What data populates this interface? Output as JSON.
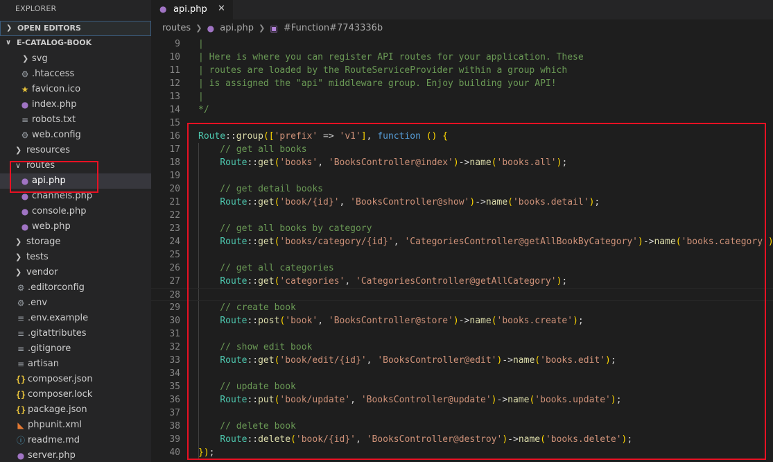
{
  "sidebar": {
    "title": "EXPLORER",
    "open_editors": "OPEN EDITORS",
    "project": "E-CATALOG-BOOK",
    "items": [
      {
        "label": "svg",
        "type": "folder",
        "level": 1,
        "icon": "chevron-right-icon"
      },
      {
        "label": ".htaccess",
        "type": "file",
        "level": 1,
        "icon": "gear-icon"
      },
      {
        "label": "favicon.ico",
        "type": "file",
        "level": 1,
        "icon": "star-icon"
      },
      {
        "label": "index.php",
        "type": "file",
        "level": 1,
        "icon": "php-icon"
      },
      {
        "label": "robots.txt",
        "type": "file",
        "level": 1,
        "icon": "lines-icon"
      },
      {
        "label": "web.config",
        "type": "file",
        "level": 1,
        "icon": "gear-icon"
      },
      {
        "label": "resources",
        "type": "folder",
        "level": 0,
        "icon": "chevron-right-icon"
      },
      {
        "label": "routes",
        "type": "folder-open",
        "level": 0,
        "icon": "chevron-down-icon"
      },
      {
        "label": "api.php",
        "type": "file",
        "level": 1,
        "icon": "php-icon",
        "selected": true
      },
      {
        "label": "channels.php",
        "type": "file",
        "level": 1,
        "icon": "php-icon"
      },
      {
        "label": "console.php",
        "type": "file",
        "level": 1,
        "icon": "php-icon"
      },
      {
        "label": "web.php",
        "type": "file",
        "level": 1,
        "icon": "php-icon"
      },
      {
        "label": "storage",
        "type": "folder",
        "level": 0,
        "icon": "chevron-right-icon"
      },
      {
        "label": "tests",
        "type": "folder",
        "level": 0,
        "icon": "chevron-right-icon"
      },
      {
        "label": "vendor",
        "type": "folder",
        "level": 0,
        "icon": "chevron-right-icon"
      },
      {
        "label": ".editorconfig",
        "type": "file",
        "level": 0,
        "icon": "gear-icon"
      },
      {
        "label": ".env",
        "type": "file",
        "level": 0,
        "icon": "gear-icon"
      },
      {
        "label": ".env.example",
        "type": "file",
        "level": 0,
        "icon": "lines-icon"
      },
      {
        "label": ".gitattributes",
        "type": "file",
        "level": 0,
        "icon": "lines-icon"
      },
      {
        "label": ".gitignore",
        "type": "file",
        "level": 0,
        "icon": "lines-icon"
      },
      {
        "label": "artisan",
        "type": "file",
        "level": 0,
        "icon": "lines-icon"
      },
      {
        "label": "composer.json",
        "type": "file",
        "level": 0,
        "icon": "json-icon"
      },
      {
        "label": "composer.lock",
        "type": "file",
        "level": 0,
        "icon": "json-icon"
      },
      {
        "label": "package.json",
        "type": "file",
        "level": 0,
        "icon": "json-icon"
      },
      {
        "label": "phpunit.xml",
        "type": "file",
        "level": 0,
        "icon": "xml-icon"
      },
      {
        "label": "readme.md",
        "type": "file",
        "level": 0,
        "icon": "info-icon"
      },
      {
        "label": "server.php",
        "type": "file",
        "level": 0,
        "icon": "php-icon"
      }
    ]
  },
  "tab": {
    "label": "api.php",
    "close": "✕"
  },
  "breadcrumb": {
    "folder": "routes",
    "file": "api.php",
    "symbol": "#Function#7743336b"
  },
  "code_lines": [
    {
      "n": "9",
      "t": "|",
      "cls": "c"
    },
    {
      "n": "10",
      "t": "| Here is where you can register API routes for your application. These",
      "cls": "c"
    },
    {
      "n": "11",
      "t": "| routes are loaded by the RouteServiceProvider within a group which",
      "cls": "c"
    },
    {
      "n": "12",
      "t": "| is assigned the \"api\" middleware group. Enjoy building your API!",
      "cls": "c"
    },
    {
      "n": "13",
      "t": "|",
      "cls": "c"
    },
    {
      "n": "14",
      "t": "*/",
      "cls": "c"
    },
    {
      "n": "15",
      "t": "",
      "cls": "p"
    },
    {
      "n": "16",
      "t": "Route::group(['prefix' => 'v1'], function () {",
      "cls": "p"
    },
    {
      "n": "17",
      "t": "    // get all books",
      "cls": "c"
    },
    {
      "n": "18",
      "t": "    Route::get('books', 'BooksController@index')->name('books.all');",
      "cls": "p"
    },
    {
      "n": "19",
      "t": "",
      "cls": "p"
    },
    {
      "n": "20",
      "t": "    // get detail books",
      "cls": "c"
    },
    {
      "n": "21",
      "t": "    Route::get('book/{id}', 'BooksController@show')->name('books.detail');",
      "cls": "p"
    },
    {
      "n": "22",
      "t": "",
      "cls": "p"
    },
    {
      "n": "23",
      "t": "    // get all books by category",
      "cls": "c"
    },
    {
      "n": "24",
      "t": "    Route::get('books/category/{id}', 'CategoriesController@getAllBookByCategory')->name('books.category');",
      "cls": "p"
    },
    {
      "n": "25",
      "t": "",
      "cls": "p"
    },
    {
      "n": "26",
      "t": "    // get all categories",
      "cls": "c"
    },
    {
      "n": "27",
      "t": "    Route::get('categories', 'CategoriesController@getAllCategory');",
      "cls": "p"
    },
    {
      "n": "28",
      "t": "",
      "cls": "p"
    },
    {
      "n": "29",
      "t": "    // create book",
      "cls": "c"
    },
    {
      "n": "30",
      "t": "    Route::post('book', 'BooksController@store')->name('books.create');",
      "cls": "p"
    },
    {
      "n": "31",
      "t": "",
      "cls": "p"
    },
    {
      "n": "32",
      "t": "    // show edit book",
      "cls": "c"
    },
    {
      "n": "33",
      "t": "    Route::get('book/edit/{id}', 'BooksController@edit')->name('books.edit');",
      "cls": "p"
    },
    {
      "n": "34",
      "t": "",
      "cls": "p"
    },
    {
      "n": "35",
      "t": "    // update book",
      "cls": "c"
    },
    {
      "n": "36",
      "t": "    Route::put('book/update', 'BooksController@update')->name('books.update');",
      "cls": "p"
    },
    {
      "n": "37",
      "t": "",
      "cls": "p"
    },
    {
      "n": "38",
      "t": "    // delete book",
      "cls": "c"
    },
    {
      "n": "39",
      "t": "    Route::delete('book/{id}', 'BooksController@destroy')->name('books.delete');",
      "cls": "p"
    },
    {
      "n": "40",
      "t": "});",
      "cls": "p"
    }
  ],
  "colors": {
    "highlight": "#e81123",
    "comment": "#6a9955",
    "string": "#ce9178",
    "class": "#4ec9b0",
    "function": "#dcdcaa"
  }
}
